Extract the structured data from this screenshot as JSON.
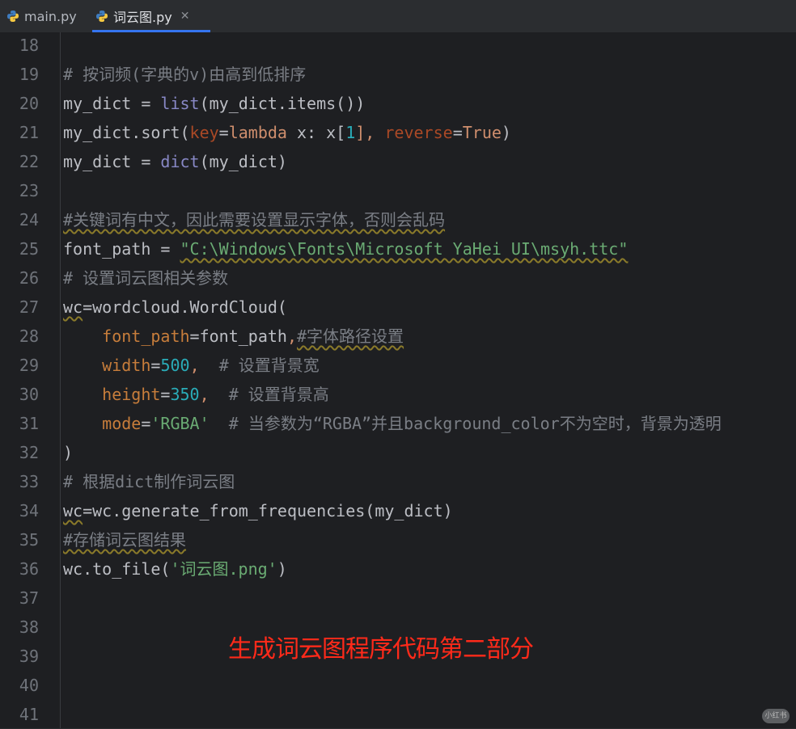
{
  "tabs": [
    {
      "label": "main.py",
      "active": false
    },
    {
      "label": "词云图.py",
      "active": true
    }
  ],
  "gutter": [
    "18",
    "19",
    "20",
    "21",
    "22",
    "23",
    "24",
    "25",
    "26",
    "27",
    "28",
    "29",
    "30",
    "31",
    "32",
    "33",
    "34",
    "35",
    "36",
    "37",
    "38",
    "39",
    "40",
    "41"
  ],
  "code": {
    "l19": "# 按词频(字典的v)由高到低排序",
    "l20a": "my_dict = ",
    "l20b": "list",
    "l20c": "(my_dict.items())",
    "l21a": "my_dict.sort(",
    "l21b": "key",
    "l21c": "=",
    "l21d": "lambda",
    "l21e": " x: x[",
    "l21f": "1",
    "l21g": "], ",
    "l21h": "reverse",
    "l21i": "=",
    "l21j": "True",
    "l21k": ")",
    "l22a": "my_dict = ",
    "l22b": "dict",
    "l22c": "(my_dict)",
    "l24": "#关键词有中文，因此需要设置显示字体，否则会乱码",
    "l25a": "font_path = ",
    "l25b": "\"C:\\Windows\\Fonts\\Microsoft YaHei UI\\msyh.ttc\"",
    "l26": "# 设置词云图相关参数",
    "l27a": "wc",
    "l27b": "=wordcloud.WordCloud(",
    "l28a": "    ",
    "l28b": "font_path",
    "l28c": "=font_path",
    "l28d": ",",
    "l28e": "#字体路径设置",
    "l29a": "    ",
    "l29b": "width",
    "l29c": "=",
    "l29d": "500",
    "l29e": ",  ",
    "l29f": "# 设置背景宽",
    "l30a": "    ",
    "l30b": "height",
    "l30c": "=",
    "l30d": "350",
    "l30e": ",  ",
    "l30f": "# 设置背景高",
    "l31a": "    ",
    "l31b": "mode",
    "l31c": "=",
    "l31d": "'RGBA'",
    "l31e": "  ",
    "l31f": "# 当参数为“RGBA”并且background_color不为空时，背景为透明",
    "l32": ")",
    "l33": "# 根据dict制作词云图",
    "l34a": "wc",
    "l34b": "=wc.generate_from_frequencies(my_dict)",
    "l35": "#存储词云图结果",
    "l36a": "wc.to_file(",
    "l36b": "'词云图.png'",
    "l36c": ")"
  },
  "caption": "生成词云图程序代码第二部分",
  "watermark": "小红书",
  "colors": {
    "background": "#1e1f22",
    "comment": "#7a7e85",
    "builtin": "#8888c6",
    "keyword": "#cf8e6d",
    "number": "#2aacb8",
    "string": "#6aab73",
    "caption": "#ff2a1a",
    "tab_underline": "#3574f0"
  }
}
